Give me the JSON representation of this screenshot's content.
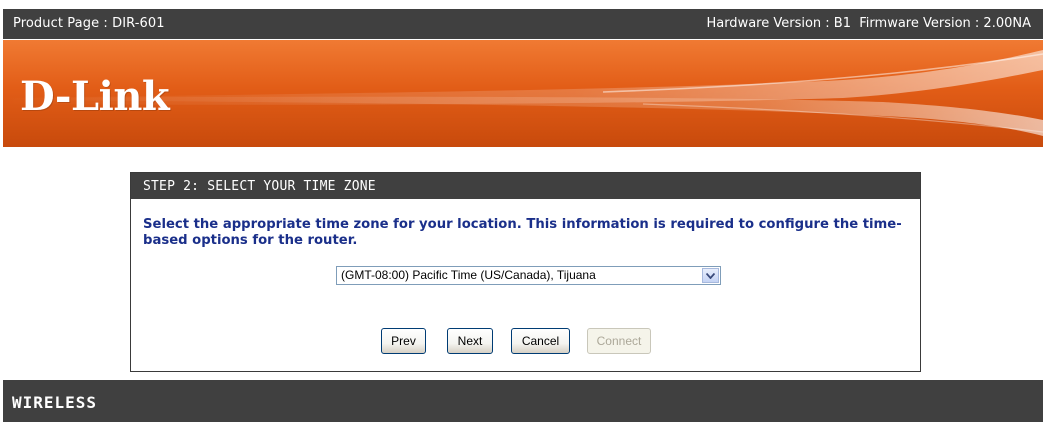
{
  "header": {
    "product_page": "Product Page : DIR-601",
    "hardware_version": "Hardware Version : B1",
    "firmware_version": "Firmware Version : 2.00NA"
  },
  "banner": {
    "logo_text": "D-Link"
  },
  "wizard": {
    "step_title": "STEP 2: SELECT YOUR TIME ZONE",
    "instruction": "Select the appropriate time zone for your location. This information is required to configure the time-based options for the router.",
    "timezone_select": {
      "selected": "(GMT-08:00) Pacific Time (US/Canada), Tijuana"
    },
    "buttons": {
      "prev": "Prev",
      "next": "Next",
      "cancel": "Cancel",
      "connect": "Connect"
    }
  },
  "footer": {
    "label": "WIRELESS"
  },
  "colors": {
    "bar": "#404040",
    "banner_orange": "#e25d17",
    "instruction_text": "#1a2f8a"
  }
}
